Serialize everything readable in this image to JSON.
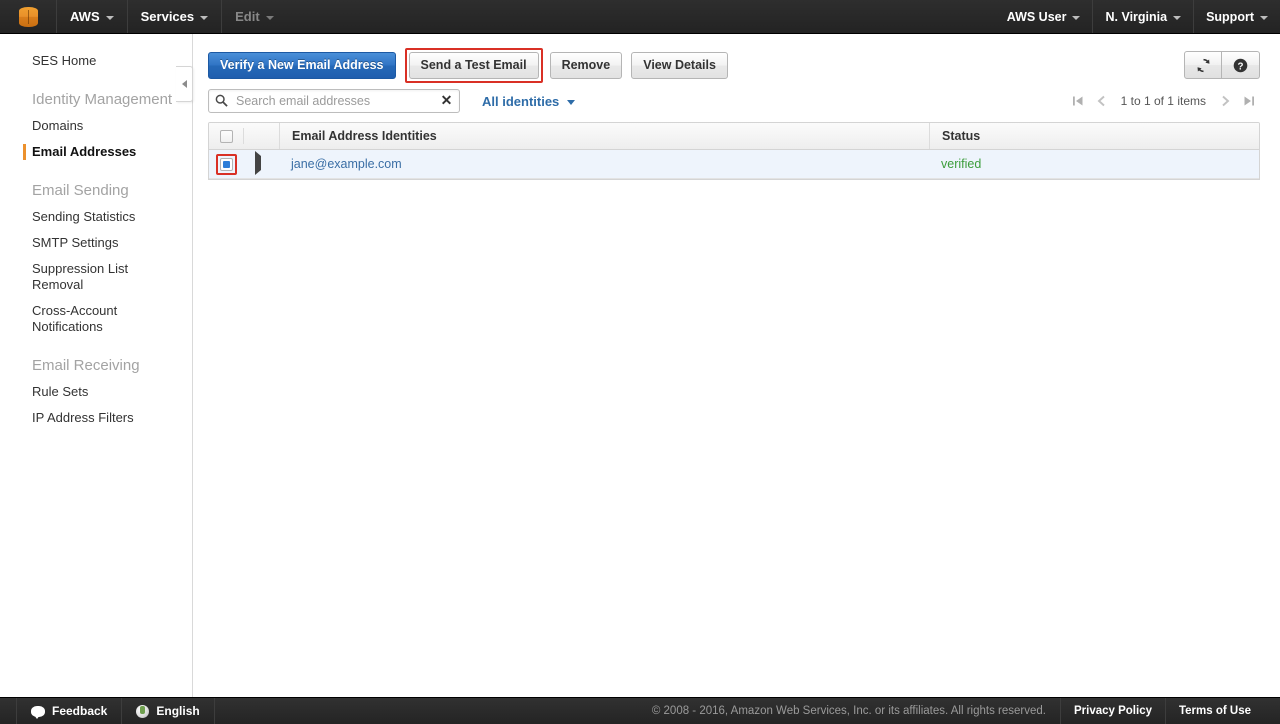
{
  "topnav": {
    "logo": "aws-cube-logo",
    "left_items": [
      {
        "label": "AWS",
        "disabled": false
      },
      {
        "label": "Services",
        "disabled": false
      },
      {
        "label": "Edit",
        "disabled": true
      }
    ],
    "right_items": [
      {
        "label": "AWS User"
      },
      {
        "label": "N. Virginia"
      },
      {
        "label": "Support"
      }
    ]
  },
  "sidebar": {
    "home_label": "SES Home",
    "groups": [
      {
        "title": "Identity Management",
        "items": [
          {
            "label": "Domains",
            "active": false
          },
          {
            "label": "Email Addresses",
            "active": true
          }
        ]
      },
      {
        "title": "Email Sending",
        "items": [
          {
            "label": "Sending Statistics",
            "active": false
          },
          {
            "label": "SMTP Settings",
            "active": false
          },
          {
            "label": "Suppression List Removal",
            "active": false
          },
          {
            "label": "Cross-Account Notifications",
            "active": false
          }
        ]
      },
      {
        "title": "Email Receiving",
        "items": [
          {
            "label": "Rule Sets",
            "active": false
          },
          {
            "label": "IP Address Filters",
            "active": false
          }
        ]
      }
    ]
  },
  "toolbar": {
    "verify_label": "Verify a New Email Address",
    "send_test_label": "Send a Test Email",
    "remove_label": "Remove",
    "view_details_label": "View Details",
    "refresh_icon": "refresh-icon",
    "help_icon": "help-icon",
    "highlight_color": "#d93025",
    "primary_color": "#2569b8"
  },
  "filterbar": {
    "search_value": "",
    "search_placeholder": "Search email addresses",
    "search_icon": "search-icon",
    "clear_icon": "clear-icon",
    "identities_filter_label": "All identities"
  },
  "pagination": {
    "first_icon": "first-page-icon",
    "prev_icon": "previous-page-icon",
    "range_label": "1 to 1 of 1 items",
    "next_icon": "next-page-icon",
    "last_icon": "last-page-icon"
  },
  "table": {
    "columns": {
      "name": "Email Address Identities",
      "status": "Status"
    },
    "header_checkbox_checked": false,
    "rows": [
      {
        "checked": true,
        "highlighted": true,
        "email": "jane@example.com",
        "status": "verified",
        "status_color": "#3c9d3c"
      }
    ]
  },
  "footer": {
    "feedback_label": "Feedback",
    "language_label": "English",
    "copyright": "© 2008 - 2016, Amazon Web Services, Inc. or its affiliates. All rights reserved.",
    "privacy_label": "Privacy Policy",
    "terms_label": "Terms of Use"
  }
}
